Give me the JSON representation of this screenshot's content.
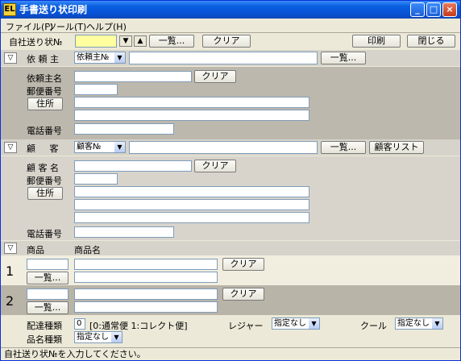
{
  "window": {
    "title": "手書送り状印刷",
    "icon_glyph": "EL",
    "minimize_glyph": "_",
    "maximize_glyph": "□",
    "close_glyph": "×"
  },
  "menu": {
    "file": "ファイル(F)",
    "tools": "ツール(T)",
    "help": "ヘルプ(H)"
  },
  "toolbar": {
    "own_number_label": "自社送り状№",
    "down_glyph": "▼",
    "up_glyph": "▲",
    "list_button": "一覧...",
    "clear_button": "クリア",
    "print_button": "印刷",
    "close_button": "閉じる"
  },
  "sender": {
    "toggle_glyph": "▽",
    "header_label": "依 頼 主",
    "select_value": "依頼主№",
    "list_button": "一覧...",
    "name_label": "依頼主名",
    "clear_button": "クリア",
    "postal_label": "郵便番号",
    "address_button": "住所",
    "phone_label": "電話番号"
  },
  "customer": {
    "toggle_glyph": "▽",
    "header_label": "顧     客",
    "select_value": "顧客№",
    "list_button": "一覧...",
    "customer_list_button": "顧客リスト",
    "name_label": "顧 客 名",
    "clear_button": "クリア",
    "postal_label": "郵便番号",
    "address_button": "住所",
    "phone_label": "電話番号"
  },
  "products": {
    "toggle_glyph": "▽",
    "col_product": "商品",
    "col_name": "商品名",
    "rows": [
      {
        "index": "1",
        "list_button": "一覧...",
        "clear_button": "クリア"
      },
      {
        "index": "2",
        "list_button": "一覧...",
        "clear_button": "クリア"
      }
    ]
  },
  "options": {
    "delivery_type_label": "配達種類",
    "delivery_type_value": "0",
    "delivery_type_hint": "[0:通常便 1:コレクト便]",
    "regular_label": "レジャー",
    "regular_value": "指定なし",
    "cool_label": "クール",
    "cool_value": "指定なし",
    "item_type_label": "品名種類",
    "item_type_value": "指定なし"
  },
  "status": {
    "message": "自社送り状№を入力してください。"
  }
}
